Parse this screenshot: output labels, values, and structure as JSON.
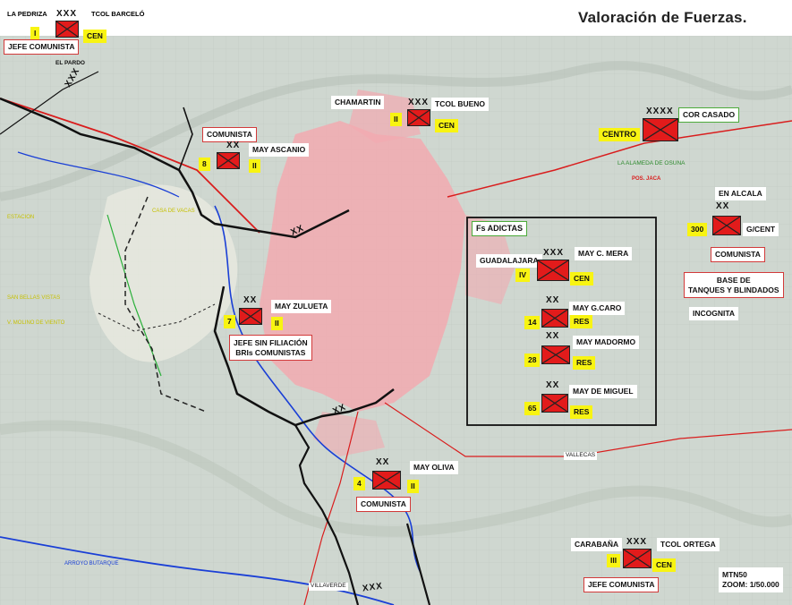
{
  "title": "Valoración de Fuerzas.",
  "colors": {
    "unit_red": "#e21b1b",
    "label_yellow": "#f8f412",
    "urban_pink": "#f2aab0",
    "front_line": "#111111",
    "road_red": "#d91d1d",
    "river_blue": "#1a3fd6",
    "box_green": "#4caa3a"
  },
  "top_left": {
    "place": "LA PEDRIZA",
    "echelon": "XXX",
    "commander": "TCOL BARCELÓ",
    "number": "I",
    "role": "CEN",
    "affiliation": "JEFE COMUNISTA"
  },
  "chamartin": {
    "place": "CHAMARTIN",
    "commander": "TCOL BUENO",
    "number": "II",
    "role": "CEN",
    "echelon": "XXX"
  },
  "centro": {
    "place": "CENTRO",
    "echelon": "XXXX",
    "commander": "COR CASADO"
  },
  "ascanio": {
    "affiliation": "COMUNISTA",
    "commander": "MAY ASCANIO",
    "number": "8",
    "role": "II",
    "echelon": "XX"
  },
  "zulueta": {
    "commander": "MAY ZULUETA",
    "number": "7",
    "role": "II",
    "echelon": "XX",
    "affiliation_line1": "JEFE SIN FILIACIÓN",
    "affiliation_line2": "BRIs COMUNISTAS"
  },
  "oliva": {
    "commander": "MAY OLIVA",
    "number": "4",
    "role": "II",
    "echelon": "XX",
    "affiliation": "COMUNISTA"
  },
  "alcala": {
    "place": "EN ALCALA",
    "number": "300",
    "role": "G/CENT",
    "echelon": "XX",
    "affiliation": "COMUNISTA"
  },
  "base": {
    "line1": "BASE DE",
    "line2": "TANQUES Y BLINDADOS",
    "status": "INCOGNITA"
  },
  "adictas": {
    "label": "Fs ADICTAS",
    "units": [
      {
        "place": "GUADALAJARA",
        "echelon": "XXX",
        "commander": "MAY C. MERA",
        "number": "IV",
        "role": "CEN"
      },
      {
        "echelon": "XX",
        "commander": "MAY G.CARO",
        "number": "14",
        "role": "RES"
      },
      {
        "echelon": "XX",
        "commander": "MAY MADORMO",
        "number": "28",
        "role": "RES"
      },
      {
        "echelon": "XX",
        "commander": "MAY DE MIGUEL",
        "number": "65",
        "role": "RES"
      }
    ]
  },
  "ortega": {
    "place": "CARABAÑA",
    "echelon": "XXX",
    "commander": "TCOL ORTEGA",
    "number": "III",
    "role": "CEN",
    "affiliation": "JEFE COMUNISTA"
  },
  "boundaries": [
    "XXX",
    "XX",
    "XX",
    "XXX"
  ],
  "map_labels": {
    "el_pardo": "EL PARDO",
    "alameda": "LA ALAMEDA DE OSUNA",
    "pos_jaca": "POS. JACA",
    "vallecas": "VALLECAS",
    "villaverde": "VILLAVERDE",
    "arroyo": "ARROYO BUTARQUE",
    "san_bellas": "SAN BELLAS VISTAS",
    "molino": "V. MOLINO DE VIENTO",
    "casa_vacas": "CASA DE VACAS",
    "estacion": "ESTACION"
  },
  "footer": {
    "sheet": "MTN50",
    "zoom": "ZOOM: 1/50.000"
  }
}
